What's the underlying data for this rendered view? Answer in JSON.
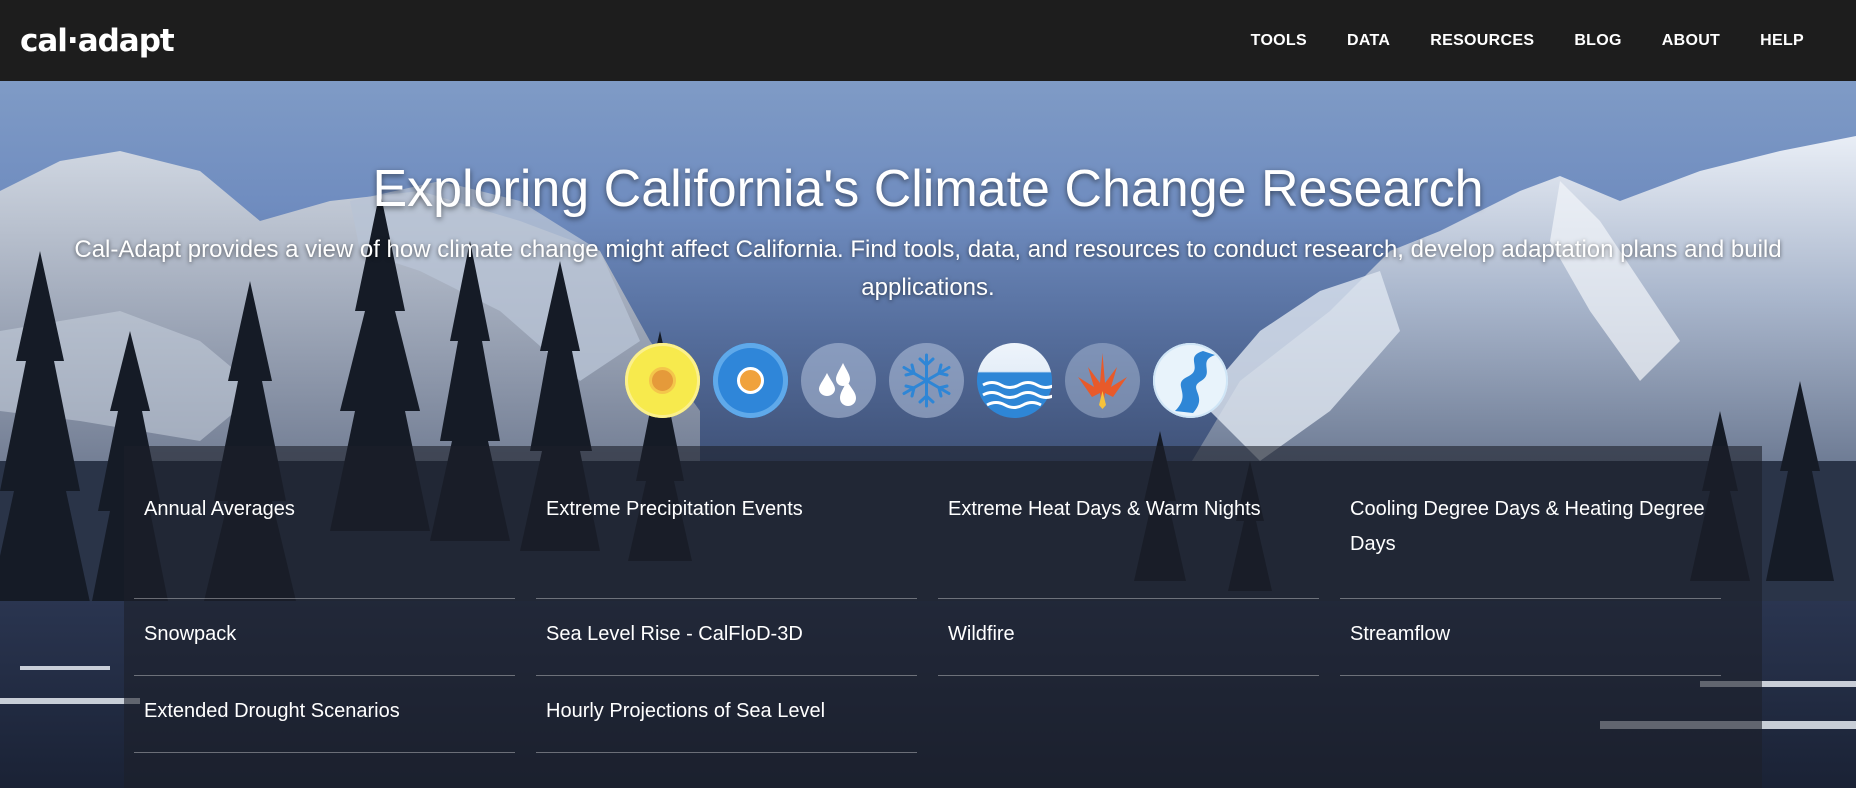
{
  "header": {
    "logo_text": "cal·adapt",
    "nav": [
      "TOOLS",
      "DATA",
      "RESOURCES",
      "BLOG",
      "ABOUT",
      "HELP"
    ]
  },
  "hero": {
    "title": "Exploring California's Climate Change Research",
    "subtitle": "Cal-Adapt provides a view of how climate change might affect California. Find tools, data, and resources to conduct research, develop adaptation plans and build applications.",
    "icons": [
      "sun-icon",
      "sun-blue-icon",
      "raindrops-icon",
      "snowflake-icon",
      "sea-waves-icon",
      "wildfire-icon",
      "streamflow-icon"
    ]
  },
  "tools": {
    "row1": [
      "Annual Averages",
      "Extreme Precipitation Events",
      "Extreme Heat Days & Warm Nights",
      "Cooling Degree Days & Heating Degree Days"
    ],
    "row2": [
      "Snowpack",
      "Sea Level Rise - CalFloD-3D",
      "Wildfire",
      "Streamflow"
    ],
    "row3": [
      "Extended Drought Scenarios",
      "Hourly Projections of Sea Level"
    ]
  },
  "colors": {
    "header_bg": "#1d1d1d",
    "panel_bg": "rgba(28,32,42,0.6)",
    "sun_yellow": "#f5e64b",
    "sun_center": "#e59a3a",
    "sky_blue": "#3b8fe0"
  }
}
